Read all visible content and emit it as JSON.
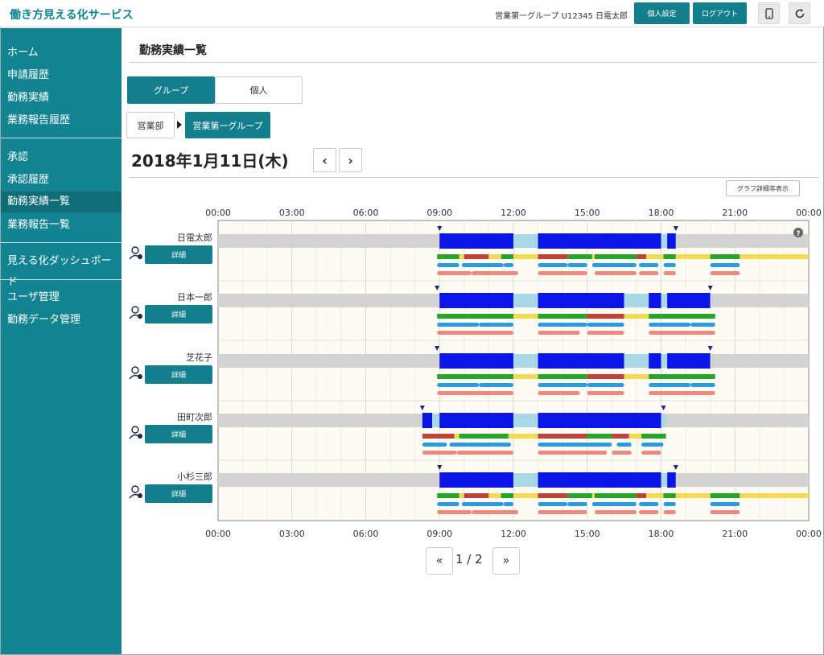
{
  "header": {
    "app_title": "働き方見える化サービス",
    "user_info": "営業第一グループ U12345 日電太郎",
    "settings_button": "個人設定",
    "logout_button": "ログアウト",
    "mobile_icon": "mobile-icon",
    "refresh_icon": "refresh-icon",
    "accent_color": "#128390"
  },
  "sidebar": {
    "items": [
      {
        "label": "ホーム"
      },
      {
        "label": "申請履歴"
      },
      {
        "label": "勤務実績"
      },
      {
        "label": "業務報告履歴"
      },
      {
        "label": "承認"
      },
      {
        "label": "承認履歴"
      },
      {
        "label": "勤務実績一覧",
        "active": true
      },
      {
        "label": "業務報告一覧"
      },
      {
        "label": "見える化ダッシュボード"
      },
      {
        "label": "ユーザ管理"
      },
      {
        "label": "勤務データ管理"
      }
    ]
  },
  "main": {
    "page_title": "勤務実績一覧",
    "tabs": [
      {
        "label": "グループ",
        "selected": true
      },
      {
        "label": "個人",
        "selected": false
      }
    ],
    "breadcrumb": [
      "営業部",
      "営業第一グループ"
    ],
    "date": "2018年1月11日(木)",
    "prev_label": "‹",
    "next_label": "›",
    "graph_toggle": "グラフ詳細非表示",
    "help_icon": "question-icon",
    "detail_label": "詳細",
    "pagination": {
      "first": "«",
      "last": "»",
      "indicator": "1 / 2"
    }
  },
  "chart_data": {
    "type": "gantt",
    "x_ticks": [
      "00:00",
      "03:00",
      "06:00",
      "09:00",
      "12:00",
      "15:00",
      "18:00",
      "21:00",
      "00:00"
    ],
    "x_range_hours": [
      0,
      24
    ],
    "colors": {
      "work": "#0b16e6",
      "break": "#a8d7e6",
      "off": "#d3d3d3",
      "green": "#27a52a",
      "yellow": "#f2da51",
      "red": "#c0423a",
      "blue": "#2a9be0",
      "salmon": "#ec8a80",
      "marker": "#1c2a6e"
    },
    "employees": [
      {
        "name": "日電太郎",
        "markers": [
          9.0,
          18.6
        ],
        "main": [
          [
            0,
            9.0,
            "off"
          ],
          [
            9.0,
            12.0,
            "work"
          ],
          [
            12.0,
            13.0,
            "break"
          ],
          [
            13.0,
            18.0,
            "work"
          ],
          [
            18.0,
            18.25,
            "break"
          ],
          [
            18.25,
            18.6,
            "work"
          ],
          [
            18.6,
            24,
            "off"
          ]
        ],
        "rows": [
          [
            [
              8.9,
              9.8,
              "green"
            ],
            [
              9.8,
              10.0,
              "yellow"
            ],
            [
              10.0,
              11.0,
              "red"
            ],
            [
              11.0,
              11.5,
              "yellow"
            ],
            [
              11.5,
              12.0,
              "green"
            ],
            [
              12.0,
              13.0,
              "yellow"
            ],
            [
              13.0,
              14.2,
              "red"
            ],
            [
              14.2,
              15.2,
              "green"
            ],
            [
              15.2,
              15.3,
              "yellow"
            ],
            [
              15.3,
              17.0,
              "green"
            ],
            [
              17.0,
              17.4,
              "red"
            ],
            [
              17.4,
              18.1,
              "yellow"
            ],
            [
              18.1,
              18.6,
              "green"
            ],
            [
              18.6,
              20.0,
              "yellow"
            ],
            [
              20.0,
              21.2,
              "green"
            ],
            [
              21.2,
              24.0,
              "yellow"
            ]
          ],
          [
            [
              8.9,
              9.8,
              "blue"
            ],
            [
              9.9,
              11.6,
              "blue"
            ],
            [
              11.6,
              12.0,
              "blue"
            ],
            [
              13.0,
              14.2,
              "blue"
            ],
            [
              14.2,
              15.0,
              "blue"
            ],
            [
              15.2,
              17.0,
              "blue"
            ],
            [
              17.1,
              17.9,
              "blue"
            ],
            [
              18.1,
              18.6,
              "blue"
            ],
            [
              20.0,
              21.2,
              "blue"
            ]
          ],
          [
            [
              8.9,
              10.3,
              "salmon"
            ],
            [
              10.3,
              11.7,
              "salmon"
            ],
            [
              11.5,
              12.2,
              "salmon"
            ],
            [
              13.0,
              15.0,
              "salmon"
            ],
            [
              15.3,
              17.0,
              "salmon"
            ],
            [
              17.1,
              17.9,
              "salmon"
            ],
            [
              18.1,
              18.6,
              "salmon"
            ],
            [
              20.0,
              21.2,
              "salmon"
            ]
          ]
        ]
      },
      {
        "name": "日本一郎",
        "markers": [
          8.9,
          20.0
        ],
        "main": [
          [
            0,
            9.0,
            "off"
          ],
          [
            9.0,
            12.0,
            "work"
          ],
          [
            12.0,
            13.0,
            "break"
          ],
          [
            13.0,
            16.5,
            "work"
          ],
          [
            16.5,
            17.5,
            "break"
          ],
          [
            17.5,
            18.0,
            "work"
          ],
          [
            18.0,
            18.25,
            "break"
          ],
          [
            18.25,
            20.0,
            "work"
          ],
          [
            20.0,
            24,
            "off"
          ]
        ],
        "rows": [
          [
            [
              8.9,
              12.0,
              "green"
            ],
            [
              12.0,
              13.0,
              "yellow"
            ],
            [
              13.0,
              15.0,
              "green"
            ],
            [
              15.0,
              16.5,
              "red"
            ],
            [
              16.5,
              17.5,
              "yellow"
            ],
            [
              17.5,
              20.2,
              "green"
            ]
          ],
          [
            [
              8.9,
              10.6,
              "blue"
            ],
            [
              10.6,
              12.0,
              "blue"
            ],
            [
              13.0,
              15.0,
              "blue"
            ],
            [
              15.0,
              16.5,
              "blue"
            ],
            [
              17.5,
              19.2,
              "blue"
            ],
            [
              19.2,
              20.2,
              "blue"
            ]
          ],
          [
            [
              8.9,
              12.0,
              "salmon"
            ],
            [
              13.0,
              14.7,
              "salmon"
            ],
            [
              15.0,
              16.5,
              "salmon"
            ],
            [
              17.5,
              20.2,
              "salmon"
            ]
          ]
        ]
      },
      {
        "name": "芝花子",
        "markers": [
          8.9,
          20.0
        ],
        "main": [
          [
            0,
            9.0,
            "off"
          ],
          [
            9.0,
            12.0,
            "work"
          ],
          [
            12.0,
            13.0,
            "break"
          ],
          [
            13.0,
            16.5,
            "work"
          ],
          [
            16.5,
            17.5,
            "break"
          ],
          [
            17.5,
            18.0,
            "work"
          ],
          [
            18.0,
            18.25,
            "break"
          ],
          [
            18.25,
            20.0,
            "work"
          ],
          [
            20.0,
            24,
            "off"
          ]
        ],
        "rows": [
          [
            [
              8.9,
              12.0,
              "green"
            ],
            [
              12.0,
              13.0,
              "yellow"
            ],
            [
              13.0,
              15.0,
              "green"
            ],
            [
              15.0,
              16.5,
              "red"
            ],
            [
              16.5,
              17.5,
              "yellow"
            ],
            [
              17.5,
              20.2,
              "green"
            ]
          ],
          [
            [
              8.9,
              10.6,
              "blue"
            ],
            [
              10.6,
              12.0,
              "blue"
            ],
            [
              13.0,
              15.0,
              "blue"
            ],
            [
              15.0,
              16.5,
              "blue"
            ],
            [
              17.5,
              19.2,
              "blue"
            ],
            [
              19.2,
              20.2,
              "blue"
            ]
          ],
          [
            [
              8.9,
              12.0,
              "salmon"
            ],
            [
              13.0,
              14.7,
              "salmon"
            ],
            [
              15.0,
              16.5,
              "salmon"
            ],
            [
              17.5,
              20.2,
              "salmon"
            ]
          ]
        ]
      },
      {
        "name": "田町次郎",
        "markers": [
          8.3,
          18.1
        ],
        "main": [
          [
            0,
            8.3,
            "off"
          ],
          [
            8.3,
            8.7,
            "work"
          ],
          [
            8.7,
            9.0,
            "break"
          ],
          [
            9.0,
            12.0,
            "work"
          ],
          [
            12.0,
            13.0,
            "break"
          ],
          [
            13.0,
            18.0,
            "work"
          ],
          [
            18.0,
            18.2,
            "break"
          ],
          [
            18.2,
            24,
            "off"
          ]
        ],
        "rows": [
          [
            [
              8.3,
              9.6,
              "red"
            ],
            [
              9.6,
              9.8,
              "yellow"
            ],
            [
              9.8,
              11.8,
              "green"
            ],
            [
              11.8,
              13.0,
              "yellow"
            ],
            [
              13.0,
              15.0,
              "red"
            ],
            [
              15.0,
              16.0,
              "green"
            ],
            [
              16.0,
              16.7,
              "red"
            ],
            [
              16.7,
              17.2,
              "yellow"
            ],
            [
              17.2,
              18.2,
              "green"
            ]
          ],
          [
            [
              8.3,
              9.3,
              "blue"
            ],
            [
              9.4,
              11.9,
              "blue"
            ],
            [
              13.0,
              16.0,
              "blue"
            ],
            [
              16.2,
              16.8,
              "blue"
            ],
            [
              17.2,
              18.1,
              "blue"
            ]
          ],
          [
            [
              8.3,
              9.7,
              "salmon"
            ],
            [
              9.7,
              12.0,
              "salmon"
            ],
            [
              13.0,
              15.8,
              "salmon"
            ],
            [
              16.0,
              16.8,
              "salmon"
            ],
            [
              17.2,
              18.0,
              "salmon"
            ]
          ]
        ]
      },
      {
        "name": "小杉三郎",
        "markers": [
          9.0,
          18.6
        ],
        "main": [
          [
            0,
            9.0,
            "off"
          ],
          [
            9.0,
            12.0,
            "work"
          ],
          [
            12.0,
            13.0,
            "break"
          ],
          [
            13.0,
            18.0,
            "work"
          ],
          [
            18.0,
            18.25,
            "break"
          ],
          [
            18.25,
            18.6,
            "work"
          ],
          [
            18.6,
            24,
            "off"
          ]
        ],
        "rows": [
          [
            [
              8.9,
              9.8,
              "green"
            ],
            [
              9.8,
              10.0,
              "yellow"
            ],
            [
              10.0,
              11.0,
              "red"
            ],
            [
              11.0,
              11.5,
              "yellow"
            ],
            [
              11.5,
              12.0,
              "green"
            ],
            [
              12.0,
              13.0,
              "yellow"
            ],
            [
              13.0,
              14.2,
              "red"
            ],
            [
              14.2,
              15.2,
              "green"
            ],
            [
              15.2,
              15.3,
              "yellow"
            ],
            [
              15.3,
              17.0,
              "green"
            ],
            [
              17.0,
              17.4,
              "red"
            ],
            [
              17.4,
              18.1,
              "yellow"
            ],
            [
              18.1,
              18.6,
              "green"
            ],
            [
              18.6,
              20.0,
              "yellow"
            ],
            [
              20.0,
              21.2,
              "green"
            ],
            [
              21.2,
              24.0,
              "yellow"
            ]
          ],
          [
            [
              8.9,
              9.8,
              "blue"
            ],
            [
              9.9,
              11.6,
              "blue"
            ],
            [
              11.6,
              12.0,
              "blue"
            ],
            [
              13.0,
              14.2,
              "blue"
            ],
            [
              14.2,
              15.0,
              "blue"
            ],
            [
              15.2,
              17.0,
              "blue"
            ],
            [
              17.1,
              17.9,
              "blue"
            ],
            [
              18.1,
              18.6,
              "blue"
            ],
            [
              20.0,
              21.2,
              "blue"
            ]
          ],
          [
            [
              8.9,
              10.3,
              "salmon"
            ],
            [
              10.3,
              11.7,
              "salmon"
            ],
            [
              11.5,
              12.2,
              "salmon"
            ],
            [
              13.0,
              15.0,
              "salmon"
            ],
            [
              15.3,
              17.0,
              "salmon"
            ],
            [
              17.1,
              17.9,
              "salmon"
            ],
            [
              18.1,
              18.6,
              "salmon"
            ],
            [
              20.0,
              21.2,
              "salmon"
            ]
          ]
        ]
      }
    ]
  }
}
